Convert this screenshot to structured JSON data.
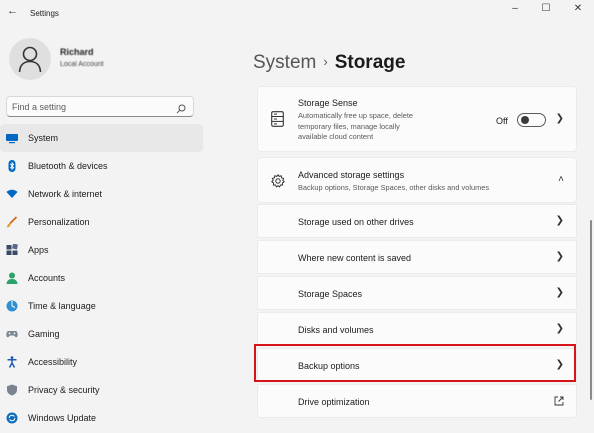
{
  "window": {
    "title": "Settings",
    "back_glyph": "←",
    "minimize_glyph": "–",
    "maximize_glyph": "☐",
    "close_glyph": "✕"
  },
  "profile": {
    "name": "Richard",
    "subtitle": "Local Account"
  },
  "search": {
    "placeholder": "Find a setting",
    "value": ""
  },
  "nav": {
    "items": [
      {
        "label": "System",
        "icon": "system-icon",
        "selected": true
      },
      {
        "label": "Bluetooth & devices",
        "icon": "bluetooth-icon"
      },
      {
        "label": "Network & internet",
        "icon": "network-icon"
      },
      {
        "label": "Personalization",
        "icon": "brush-icon"
      },
      {
        "label": "Apps",
        "icon": "apps-icon"
      },
      {
        "label": "Accounts",
        "icon": "accounts-icon"
      },
      {
        "label": "Time & language",
        "icon": "globe-clock-icon"
      },
      {
        "label": "Gaming",
        "icon": "gamepad-icon"
      },
      {
        "label": "Accessibility",
        "icon": "accessibility-icon"
      },
      {
        "label": "Privacy & security",
        "icon": "shield-icon"
      },
      {
        "label": "Windows Update",
        "icon": "update-icon"
      }
    ]
  },
  "breadcrumb": {
    "parent": "System",
    "separator": "›",
    "current": "Storage"
  },
  "storage_sense": {
    "title": "Storage Sense",
    "description": "Automatically free up space, delete temporary files, manage locally available cloud content",
    "state": "Off",
    "toggle_on": false
  },
  "advanced": {
    "title": "Advanced storage settings",
    "description": "Backup options, Storage Spaces, other disks and volumes",
    "expanded": true,
    "items": [
      {
        "label": "Storage used on other drives",
        "trailing": "chevron-right-icon"
      },
      {
        "label": "Where new content is saved",
        "trailing": "chevron-right-icon"
      },
      {
        "label": "Storage Spaces",
        "trailing": "chevron-right-icon"
      },
      {
        "label": "Disks and volumes",
        "trailing": "chevron-right-icon"
      },
      {
        "label": "Backup options",
        "trailing": "chevron-right-icon",
        "highlighted": true
      },
      {
        "label": "Drive optimization",
        "trailing": "external-link-icon"
      }
    ]
  },
  "colors": {
    "accent": "#0067c0",
    "highlight_border": "#d7141a",
    "background": "#f3f3f3",
    "card": "#fbfbfb"
  }
}
